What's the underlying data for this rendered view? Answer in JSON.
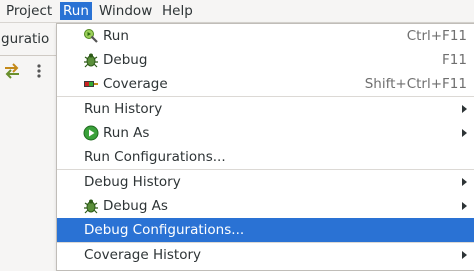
{
  "menubar": {
    "items": [
      {
        "label": "Project"
      },
      {
        "label": "Run",
        "active": true
      },
      {
        "label": "Window"
      },
      {
        "label": "Help"
      }
    ]
  },
  "toolbar": {
    "partial_label": "nfiguratio"
  },
  "colors": {
    "selection": "#2a72d4",
    "menu_bg": "#ffffff",
    "window_bg": "#f6f5f4"
  },
  "run_menu": {
    "items": [
      {
        "label": "Run",
        "accelerator": "Ctrl+F11",
        "icon": "run-launch-icon"
      },
      {
        "label": "Debug",
        "accelerator": "F11",
        "icon": "debug-bug-icon"
      },
      {
        "label": "Coverage",
        "accelerator": "Shift+Ctrl+F11",
        "icon": "coverage-icon"
      },
      {
        "label": "Run History",
        "submenu": true
      },
      {
        "label": "Run As",
        "submenu": true,
        "icon": "run-as-play-icon"
      },
      {
        "label": "Run Configurations..."
      },
      {
        "label": "Debug History",
        "submenu": true
      },
      {
        "label": "Debug As",
        "submenu": true,
        "icon": "debug-bug-icon"
      },
      {
        "label": "Debug Configurations...",
        "selected": true
      },
      {
        "label": "Coverage History",
        "submenu": true
      }
    ]
  }
}
